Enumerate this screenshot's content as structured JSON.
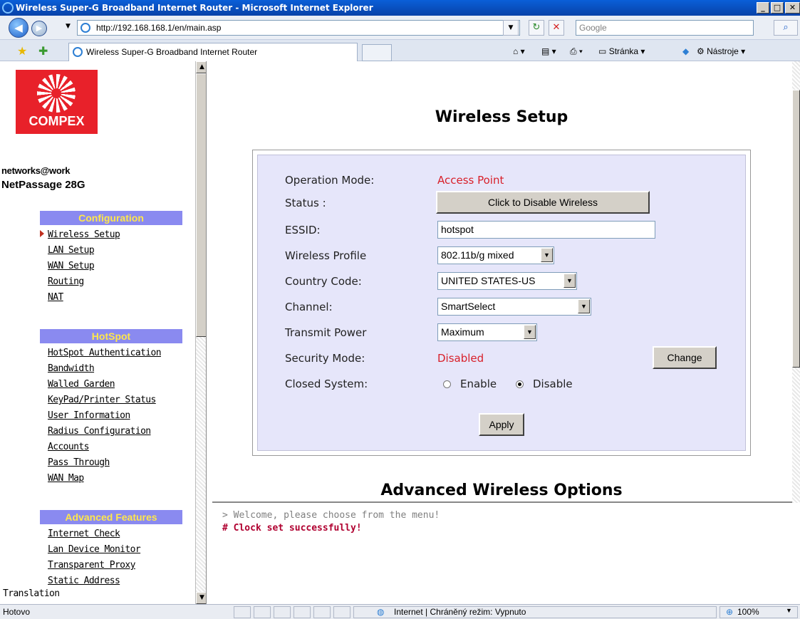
{
  "window": {
    "title": "Wireless Super-G Broadband Internet Router - Microsoft Internet Explorer",
    "min_label": "_",
    "max_label": "□",
    "close_label": "✕"
  },
  "addressbar": {
    "url": "http://192.168.168.1/en/main.asp",
    "search_placeholder": "Google"
  },
  "tabs": {
    "active_label": "Wireless Super-G Broadband Internet Router",
    "tools": [
      "Stránka ▾",
      "Nástroje ▾"
    ]
  },
  "sidebar": {
    "brand": "COMPEX",
    "tagline": "networks@work",
    "product": "NetPassage 28G",
    "sections": [
      {
        "title": "Configuration",
        "items": [
          "Wireless Setup",
          "LAN Setup",
          "WAN Setup",
          "Routing",
          "NAT"
        ]
      },
      {
        "title": "HotSpot",
        "items": [
          "HotSpot Authentication",
          "Bandwidth",
          "Walled Garden",
          "KeyPad/Printer Status",
          "User Information",
          "Radius Configuration",
          "Accounts",
          "Pass Through",
          "WAN Map"
        ]
      },
      {
        "title": "Advanced Features",
        "items": [
          "Internet Check",
          "Lan Device Monitor",
          "Transparent Proxy",
          "Static Address",
          "Translation"
        ]
      }
    ],
    "active_item": "Wireless Setup"
  },
  "main": {
    "title": "Wireless Setup",
    "fields": {
      "operation_mode_label": "Operation Mode:",
      "operation_mode_value": "Access Point",
      "status_label": "Status :",
      "status_button": "Click to Disable Wireless",
      "essid_label": "ESSID:",
      "essid_value": "hotspot",
      "profile_label": "Wireless Profile",
      "profile_value": "802.11b/g mixed",
      "country_label": "Country Code:",
      "country_value": "UNITED STATES-US",
      "channel_label": "Channel:",
      "channel_value": "SmartSelect",
      "power_label": "Transmit Power",
      "power_value": "Maximum",
      "security_label": "Security Mode:",
      "security_value": "Disabled",
      "security_button": "Change",
      "closed_label": "Closed System:",
      "closed_enable": "Enable",
      "closed_disable": "Disable",
      "closed_selected": "Disable"
    },
    "apply_button": "Apply",
    "advanced_title": "Advanced Wireless Options"
  },
  "console": {
    "line1": "> Welcome, please choose from the menu!",
    "line2": "# Clock set successfully!"
  },
  "statusbar": {
    "left": "Hotovo",
    "zone": "Internet | Chráněný režim: Vypnuto",
    "zoom": "100%"
  },
  "colors": {
    "title_bar": "#0a5fd8",
    "section_bg": "#8a8af0",
    "section_text": "#ffe74a",
    "panel_bg": "#e6e6fa",
    "red_value": "#d8202a",
    "console_red": "#b00030"
  }
}
